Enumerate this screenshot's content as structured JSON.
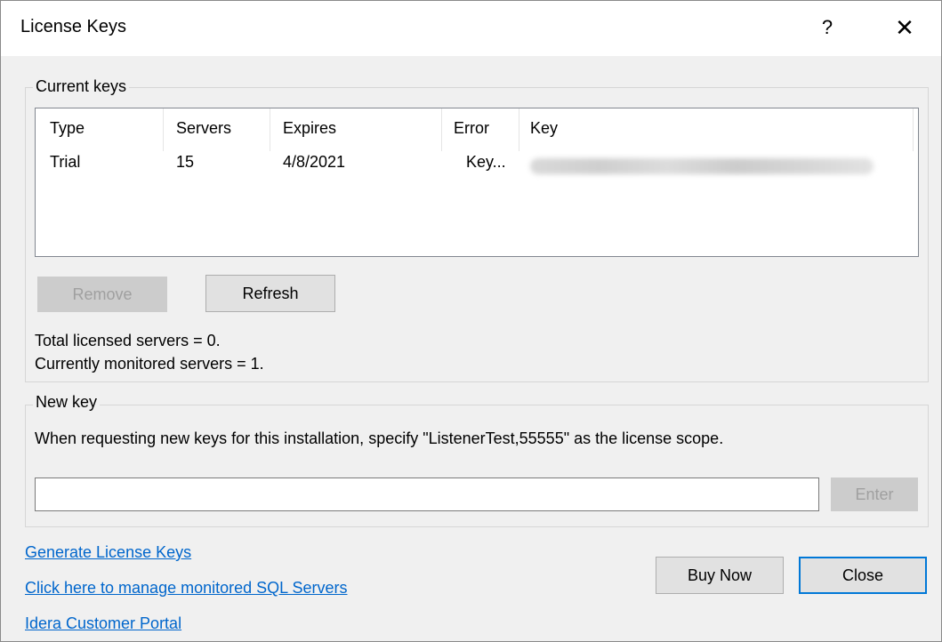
{
  "window": {
    "title": "License Keys",
    "help_glyph": "?",
    "close_glyph": "✕"
  },
  "current_keys": {
    "group_label": "Current keys",
    "columns": [
      "Type",
      "Servers",
      "Expires",
      "Error",
      "Key"
    ],
    "rows": [
      {
        "type": "Trial",
        "servers": "15",
        "expires": "4/8/2021",
        "error": "Key...",
        "key": ""
      }
    ],
    "remove_label": "Remove",
    "refresh_label": "Refresh",
    "total_licensed": "Total licensed servers = 0.",
    "currently_monitored": "Currently monitored servers = 1."
  },
  "new_key": {
    "group_label": "New key",
    "instruction": "When requesting new keys for this installation, specify \"ListenerTest,55555\" as the license scope.",
    "input_value": "",
    "enter_label": "Enter"
  },
  "links": {
    "generate": "Generate License Keys",
    "manage": "Click here to manage monitored SQL Servers",
    "portal": "Idera Customer Portal"
  },
  "buttons": {
    "buy_now": "Buy Now",
    "close": "Close"
  },
  "colors": {
    "link": "#0066cc",
    "default_button_border": "#0078d7",
    "disabled_text": "#a0a0a0"
  }
}
